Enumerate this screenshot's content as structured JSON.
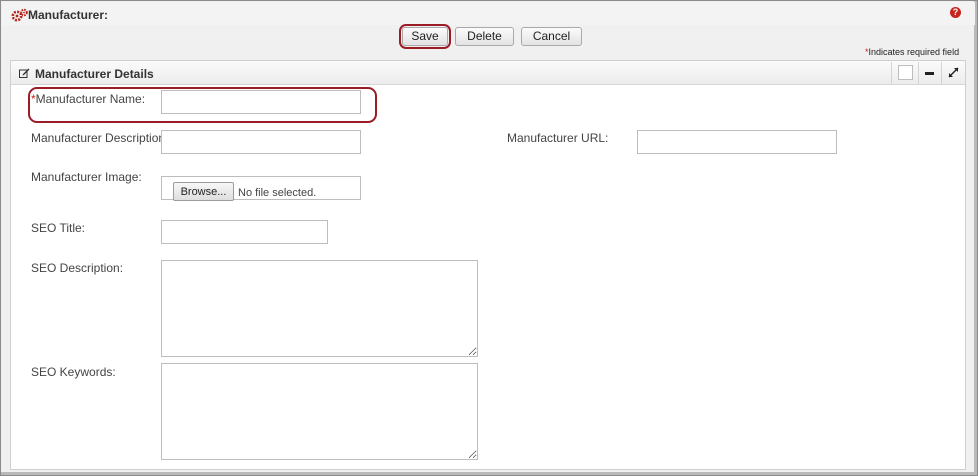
{
  "header": {
    "title": "Manufacturer:",
    "help_icon": "?",
    "title_icon": "gears-icon"
  },
  "toolbar": {
    "save_label": "Save",
    "delete_label": "Delete",
    "cancel_label": "Cancel"
  },
  "required_note": {
    "star": "*",
    "text": "Indicates required field"
  },
  "panel": {
    "title": "Manufacturer Details",
    "icons": [
      "edit-icon",
      "minimize-icon",
      "expand-icon"
    ]
  },
  "form": {
    "manufacturer_name": {
      "star": "*",
      "label": "Manufacturer Name:",
      "value": ""
    },
    "manufacturer_description": {
      "label": "Manufacturer Description:",
      "value": ""
    },
    "manufacturer_url": {
      "label": "Manufacturer URL:",
      "value": ""
    },
    "manufacturer_image": {
      "label": "Manufacturer Image:",
      "browse_label": "Browse...",
      "file_status": "No file selected."
    },
    "seo_title": {
      "label": "SEO Title:",
      "value": ""
    },
    "seo_description": {
      "label": "SEO Description:",
      "value": ""
    },
    "seo_keywords": {
      "label": "SEO Keywords:",
      "value": ""
    }
  },
  "colors": {
    "highlight": "#9b1c24",
    "required_star": "#c8231c",
    "toolbar_bg": "#f0f0f0"
  }
}
